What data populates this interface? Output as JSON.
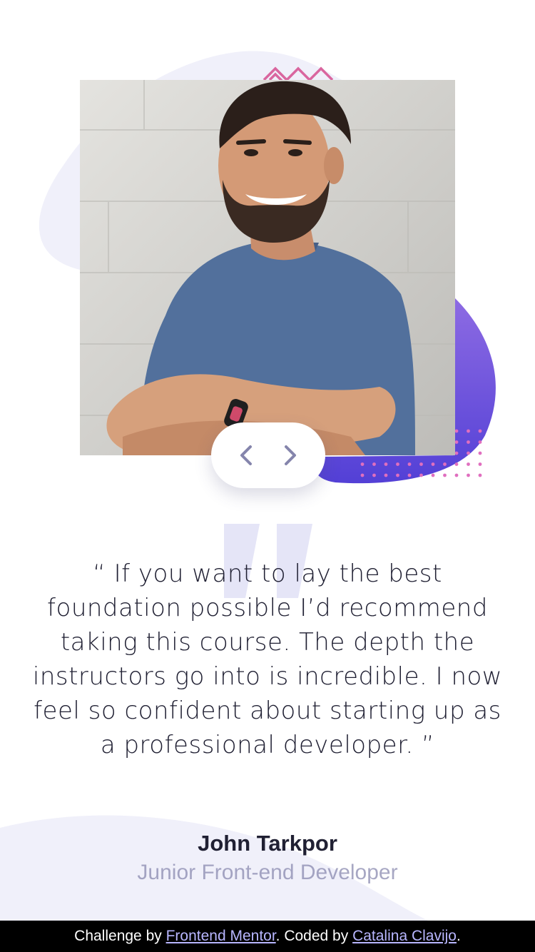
{
  "testimonial": {
    "quote": "“ If you want to lay the best foundation possible I’d recommend taking this course. The depth the instructors go into is incredible. I now feel so confident about starting up as a professional developer. ”",
    "author_name": "John Tarkpor",
    "author_role": "Junior Front-end Developer"
  },
  "nav": {
    "prev_icon": "chevron-left-icon",
    "next_icon": "chevron-right-icon"
  },
  "footer": {
    "prefix": "Challenge by ",
    "link1": "Frontend Mentor",
    "middle": ". Coded by ",
    "link2": "Catalina Clavijo",
    "suffix": "."
  },
  "colors": {
    "accent_purple": "#6c5ce7",
    "dot_pink": "#e06fbf",
    "zigzag_pink": "#d9669f",
    "blob_light": "#f0f0fa",
    "quote_mark": "#e5e5f7",
    "text_dark": "#202033",
    "text_muted": "#8a8ab0",
    "chevron": "#8585ac"
  }
}
